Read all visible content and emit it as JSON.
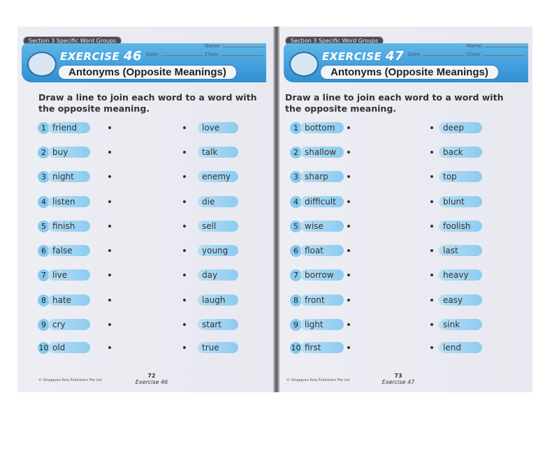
{
  "pages": [
    {
      "section": "Section 3  Specific Word Groups",
      "exercise_label": "EXERCISE",
      "exercise_number": "46",
      "title": "Antonyms (Opposite Meanings)",
      "name_label": "Name:",
      "date_label": "Date:",
      "class_label": "Class:",
      "instruction": "Draw a line to join each word to a word with the opposite meaning.",
      "left_words": [
        "friend",
        "buy",
        "night",
        "listen",
        "finish",
        "false",
        "live",
        "hate",
        "cry",
        "old"
      ],
      "right_words": [
        "love",
        "talk",
        "enemy",
        "die",
        "sell",
        "young",
        "day",
        "laugh",
        "start",
        "true"
      ],
      "copyright": "© Singapore Asia Publishers Pte Ltd",
      "page_number": "72",
      "footer_exercise": "Exercise 46"
    },
    {
      "section": "Section 3  Specific Word Groups",
      "exercise_label": "EXERCISE",
      "exercise_number": "47",
      "title": "Antonyms (Opposite Meanings)",
      "name_label": "Name:",
      "date_label": "Date:",
      "class_label": "Class:",
      "instruction": "Draw a line to join each word to a word with the opposite meaning.",
      "left_words": [
        "bottom",
        "shallow",
        "sharp",
        "difficult",
        "wise",
        "float",
        "borrow",
        "front",
        "light",
        "first"
      ],
      "right_words": [
        "deep",
        "back",
        "top",
        "blunt",
        "foolish",
        "last",
        "heavy",
        "easy",
        "sink",
        "lend"
      ],
      "copyright": "© Singapore Asia Publishers Pte Ltd",
      "page_number": "73",
      "footer_exercise": "Exercise 47"
    }
  ],
  "colors": {
    "banner": "#3a9ade",
    "pill": "#9fd3f2",
    "number_badge": "#8ac9ee"
  }
}
